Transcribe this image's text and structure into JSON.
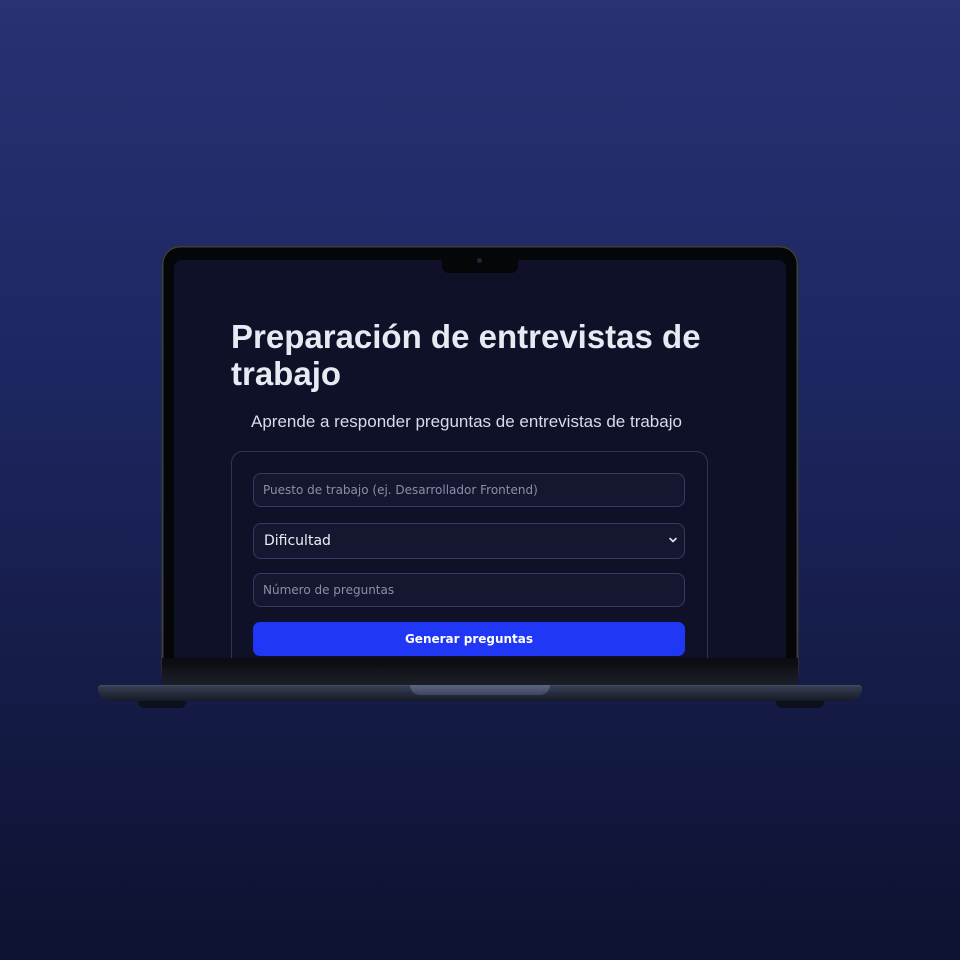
{
  "app": {
    "title": "Preparación de entrevistas de trabajo",
    "subtitle": "Aprende a responder preguntas de entrevistas de trabajo"
  },
  "form": {
    "job_title": {
      "value": "",
      "placeholder": "Puesto de trabajo (ej. Desarrollador Frontend)"
    },
    "difficulty": {
      "selected": "Dificultad",
      "icon": "chevron-down-icon"
    },
    "question_count": {
      "value": "",
      "placeholder": "Número de preguntas"
    },
    "submit_label": "Generar preguntas"
  },
  "colors": {
    "background_top": "#283274",
    "background_bottom": "#0d1230",
    "screen_background": "#0f1129",
    "accent_button": "#2037f5",
    "field_border": "#363b63"
  }
}
